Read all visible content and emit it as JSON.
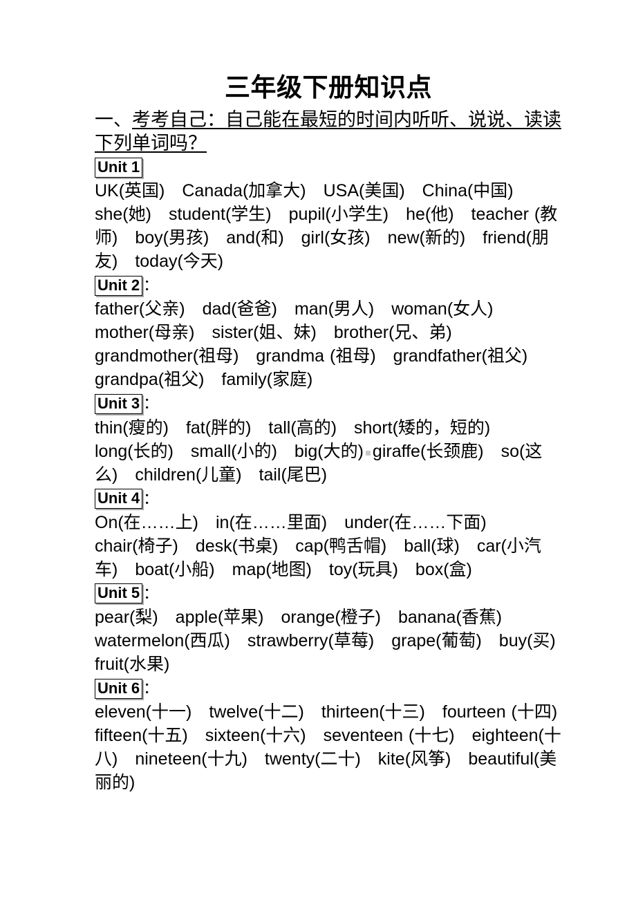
{
  "document": {
    "title": "三年级下册知识点",
    "section_heading": {
      "enumeration": "一、",
      "underlined_text": "考考自己：自己能在最短的时间内听听、说说、读读下列单词吗？"
    }
  },
  "units": [
    {
      "badge": "Unit 1",
      "colon": "",
      "words": "UK(英国)　Canada(加拿大)　USA(美国)　China(中国)　she(她)　student(学生)　pupil(小学生)　he(他)　teacher (教师)　boy(男孩)　and(和)　girl(女孩)　new(新的)　friend(朋友)　today(今天)",
      "word_items": [
        {
          "en": "UK",
          "cn": "英国"
        },
        {
          "en": "Canada",
          "cn": "加拿大"
        },
        {
          "en": "USA",
          "cn": "美国"
        },
        {
          "en": "China",
          "cn": "中国"
        },
        {
          "en": "she",
          "cn": "她"
        },
        {
          "en": "student",
          "cn": "学生"
        },
        {
          "en": "pupil",
          "cn": "小学生"
        },
        {
          "en": "he",
          "cn": "他"
        },
        {
          "en": "teacher",
          "cn": "教师"
        },
        {
          "en": "boy",
          "cn": "男孩"
        },
        {
          "en": "and",
          "cn": "和"
        },
        {
          "en": "girl",
          "cn": "女孩"
        },
        {
          "en": "new",
          "cn": "新的"
        },
        {
          "en": "friend",
          "cn": "朋友"
        },
        {
          "en": "today",
          "cn": "今天"
        }
      ]
    },
    {
      "badge": "Unit 2",
      "colon": "：",
      "words": "father(父亲)　dad(爸爸)　man(男人)　woman(女人)　mother(母亲)　sister(姐、妹)　brother(兄、弟) grandmother(祖母)　grandma (祖母)　grandfather(祖父)　grandpa(祖父)　family(家庭)",
      "word_items": [
        {
          "en": "father",
          "cn": "父亲"
        },
        {
          "en": "dad",
          "cn": "爸爸"
        },
        {
          "en": "man",
          "cn": "男人"
        },
        {
          "en": "woman",
          "cn": "女人"
        },
        {
          "en": "mother",
          "cn": "母亲"
        },
        {
          "en": "sister",
          "cn": "姐、妹"
        },
        {
          "en": "brother",
          "cn": "兄、弟"
        },
        {
          "en": "grandmother",
          "cn": "祖母"
        },
        {
          "en": "grandma",
          "cn": "祖母"
        },
        {
          "en": "grandfather",
          "cn": "祖父"
        },
        {
          "en": "grandpa",
          "cn": "祖父"
        },
        {
          "en": "family",
          "cn": "家庭"
        }
      ]
    },
    {
      "badge": "Unit 3",
      "colon": "：",
      "words_part1": "thin(瘦的)　fat(胖的)　tall(高的)　short(矮的，短的)　long(长的)　small(小的)　big(大的)",
      "words_part2": "giraffe(长颈鹿)　so(这么)　children(儿童)　tail(尾巴)",
      "word_items": [
        {
          "en": "thin",
          "cn": "瘦的"
        },
        {
          "en": "fat",
          "cn": "胖的"
        },
        {
          "en": "tall",
          "cn": "高的"
        },
        {
          "en": "short",
          "cn": "矮的，短的"
        },
        {
          "en": "long",
          "cn": "长的"
        },
        {
          "en": "small",
          "cn": "小的"
        },
        {
          "en": "big",
          "cn": "大的"
        },
        {
          "en": "giraffe",
          "cn": "长颈鹿"
        },
        {
          "en": "so",
          "cn": "这么"
        },
        {
          "en": "children",
          "cn": "儿童"
        },
        {
          "en": "tail",
          "cn": "尾巴"
        }
      ]
    },
    {
      "badge": "Unit 4",
      "colon": "：",
      "words": "On(在……上)　in(在……里面)　under(在……下面)　chair(椅子)　desk(书桌)　cap(鸭舌帽)　ball(球)　car(小汽车)　boat(小船)　map(地图)　toy(玩具)　box(盒)",
      "word_items": [
        {
          "en": "On",
          "cn": "在……上"
        },
        {
          "en": "in",
          "cn": "在……里面"
        },
        {
          "en": "under",
          "cn": "在……下面"
        },
        {
          "en": "chair",
          "cn": "椅子"
        },
        {
          "en": "desk",
          "cn": "书桌"
        },
        {
          "en": "cap",
          "cn": "鸭舌帽"
        },
        {
          "en": "ball",
          "cn": "球"
        },
        {
          "en": "car",
          "cn": "小汽车"
        },
        {
          "en": "boat",
          "cn": "小船"
        },
        {
          "en": "map",
          "cn": "地图"
        },
        {
          "en": "toy",
          "cn": "玩具"
        },
        {
          "en": "box",
          "cn": "盒"
        }
      ]
    },
    {
      "badge": "Unit 5",
      "colon": "：",
      "words": "pear(梨)　apple(苹果)　orange(橙子)　banana(香蕉)　watermelon(西瓜)　strawberry(草莓)　grape(葡萄)　buy(买)　fruit(水果)",
      "word_items": [
        {
          "en": "pear",
          "cn": "梨"
        },
        {
          "en": "apple",
          "cn": "苹果"
        },
        {
          "en": "orange",
          "cn": "橙子"
        },
        {
          "en": "banana",
          "cn": "香蕉"
        },
        {
          "en": "watermelon",
          "cn": "西瓜"
        },
        {
          "en": "strawberry",
          "cn": "草莓"
        },
        {
          "en": "grape",
          "cn": "葡萄"
        },
        {
          "en": "buy",
          "cn": "买"
        },
        {
          "en": "fruit",
          "cn": "水果"
        }
      ]
    },
    {
      "badge": "Unit 6",
      "colon": "：",
      "words": "eleven(十一)　twelve(十二)　thirteen(十三)　fourteen (十四)　fifteen(十五)　sixteen(十六)　seventeen (十七)　eighteen(十八)　nineteen(十九)　twenty(二十)　kite(风筝)　beautiful(美丽的)",
      "word_items": [
        {
          "en": "eleven",
          "cn": "十一"
        },
        {
          "en": "twelve",
          "cn": "十二"
        },
        {
          "en": "thirteen",
          "cn": "十三"
        },
        {
          "en": "fourteen",
          "cn": "十四"
        },
        {
          "en": "fifteen",
          "cn": "十五"
        },
        {
          "en": "sixteen",
          "cn": "十六"
        },
        {
          "en": "seventeen",
          "cn": "十七"
        },
        {
          "en": "eighteen",
          "cn": "十八"
        },
        {
          "en": "nineteen",
          "cn": "十九"
        },
        {
          "en": "twenty",
          "cn": "二十"
        },
        {
          "en": "kite",
          "cn": "风筝"
        },
        {
          "en": "beautiful",
          "cn": "美丽的"
        }
      ]
    }
  ]
}
